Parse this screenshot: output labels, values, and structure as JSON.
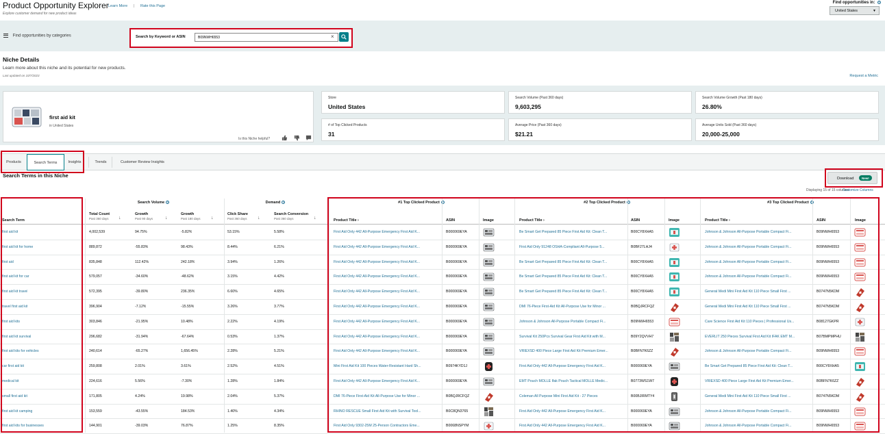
{
  "header": {
    "title": "Product Opportunity Explorer",
    "learn_more": "Learn More",
    "separator": "|",
    "rate_page": "Rate this Page",
    "subtitle": "Explore customer demand for new product ideas",
    "find_label": "Find opportunities in:",
    "country": "United States"
  },
  "search": {
    "categories_label": "Find opportunities by categories",
    "label": "Search by Keyword or ASIN",
    "value": "B09NWH6553"
  },
  "niche_details": {
    "title": "Niche Details",
    "description": "Learn more about this niche and its potential for new products.",
    "updated": "Last updated on 10/7/2023",
    "request_metric": "Request a Metric",
    "niche_name": "first aid kit",
    "niche_location": "in United States",
    "helpful": "Is this Niche helpful?",
    "stats": [
      {
        "label": "Store",
        "value": "United States"
      },
      {
        "label": "Search Volume (Past 360 days)",
        "value": "9,603,295"
      },
      {
        "label": "Search Volume Growth (Past 180 days)",
        "value": "26.80%"
      },
      {
        "label": "# of Top Clicked Products",
        "value": "31"
      },
      {
        "label": "Average Price (Past 360 days)",
        "value": "$21.21"
      },
      {
        "label": "Average Units Sold (Past 360 days)",
        "value": "20,000-25,000"
      }
    ]
  },
  "tabs": [
    "Products",
    "Search Terms",
    "Insights",
    "Trends",
    "Customer Review Insights"
  ],
  "section": {
    "title": "Search Terms in this Niche",
    "download": "Download",
    "new_badge": "New!",
    "displaying": "Displaying 15 of 15 columns",
    "customize": "Customize Columns"
  },
  "table": {
    "groups": {
      "search_volume": "Search Volume",
      "demand": "Demand",
      "top1": "#1 Top Clicked Product",
      "top2": "#2 Top Clicked Product",
      "top3": "#3 Top Clicked Product"
    },
    "columns": {
      "term": "Search Term",
      "total": "Total Count",
      "total_sub": "Past 360 days",
      "g90": "Growth",
      "g90_sub": "Past 90 days",
      "g180": "Growth",
      "g180_sub": "Past 180 days",
      "click": "Click Share",
      "click_sub": "Past 360 days",
      "conv": "Search Conversion",
      "conv_sub": "Past 360 days",
      "title": "Product Title",
      "asin": "ASIN",
      "image": "Image"
    },
    "rows": [
      {
        "term": "first aid kit",
        "total": "4,002,539",
        "g90": "94.75%",
        "g180": "-5.82%",
        "click": "53.15%",
        "conv": "5.58%",
        "p1": "First Aid Only 442 All-Purpose Emergency First Aid K...",
        "a1": "B000069EYA",
        "i1": "kit-box",
        "p2": "Be Smart Get Prepared 85 Piece First Aid Kit: Clean T...",
        "a2": "B00CY8XHA5",
        "i2": "kit-teal",
        "p3": "Johnson & Johnson All-Purpose Portable Compact Fi...",
        "a3": "B09NWH6553",
        "i3": "kit-red"
      },
      {
        "term": "first aid kit for home",
        "total": "889,872",
        "g90": "-55.83%",
        "g180": "98.43%",
        "click": "8.44%",
        "conv": "6.21%",
        "p1": "First Aid Only 442 All-Purpose Emergency First Aid K...",
        "a1": "B000069EYA",
        "i1": "kit-box",
        "p2": "First Aid Only 91248 OSHA-Compliant All-Purpose 5...",
        "a2": "B0BF27LHJ4",
        "i2": "kit-white",
        "p3": "Johnson & Johnson All-Purpose Portable Compact Fi...",
        "a3": "B09NWH6553",
        "i3": "kit-red"
      },
      {
        "term": "first aid",
        "total": "835,848",
        "g90": "112.42%",
        "g180": "242.18%",
        "click": "3.94%",
        "conv": "1.26%",
        "p1": "First Aid Only 442 All-Purpose Emergency First Aid K...",
        "a1": "B000069EYA",
        "i1": "kit-box",
        "p2": "Be Smart Get Prepared 85 Piece First Aid Kit: Clean T...",
        "a2": "B00CY8XHA5",
        "i2": "kit-teal",
        "p3": "Johnson & Johnson All-Purpose Portable Compact Fi...",
        "a3": "B09NWH6553",
        "i3": "kit-red"
      },
      {
        "term": "first aid kit for car",
        "total": "579,057",
        "g90": "-34.60%",
        "g180": "-48.62%",
        "click": "3.15%",
        "conv": "4.42%",
        "p1": "First Aid Only 442 All-Purpose Emergency First Aid K...",
        "a1": "B000069EYA",
        "i1": "kit-box",
        "p2": "Be Smart Get Prepared 85 Piece First Aid Kit: Clean T...",
        "a2": "B00CY8XHA5",
        "i2": "kit-teal",
        "p3": "Johnson & Johnson All-Purpose Portable Compact Fi...",
        "a3": "B09NWH6553",
        "i3": "kit-red"
      },
      {
        "term": "first aid kit travel",
        "total": "572,395",
        "g90": "-39.80%",
        "g180": "236.35%",
        "click": "6.60%",
        "conv": "4.65%",
        "p1": "First Aid Only 442 All-Purpose Emergency First Aid K...",
        "a1": "B000069EYA",
        "i1": "kit-box",
        "p2": "Be Smart Get Prepared 85 Piece First Aid Kit: Clean T...",
        "a2": "B00CY8XHA5",
        "i2": "kit-teal",
        "p3": "General Medi Mini First Aid Kit 110 Piece Small First ...",
        "a3": "B0747N5KDM",
        "i3": "kit-red-bag"
      },
      {
        "term": "travel first aid kit",
        "total": "396,904",
        "g90": "-7.12%",
        "g180": "-15.55%",
        "click": "3.26%",
        "conv": "3.77%",
        "p1": "First Aid Only 442 All-Purpose Emergency First Aid K...",
        "a1": "B000069EYA",
        "i1": "kit-box",
        "p2": "DMI 76-Piece First-Aid Kit All-Purpose Use for Minor ...",
        "a2": "B0BQJRCFQZ",
        "i2": "kit-red-bag",
        "p3": "General Medi Mini First Aid Kit 110 Piece Small First ...",
        "a3": "B0747N5KDM",
        "i3": "kit-red-bag"
      },
      {
        "term": "first aid kits",
        "total": "303,846",
        "g90": "-21.95%",
        "g180": "10.48%",
        "click": "2.22%",
        "conv": "4.19%",
        "p1": "First Aid Only 442 All-Purpose Emergency First Aid K...",
        "a1": "B000069EYA",
        "i1": "kit-box",
        "p2": "Johnson & Johnson All-Purpose Portable Compact Fi...",
        "a2": "B09NWH6553",
        "i2": "kit-red",
        "p3": "Care Science First Aid Kit 110 Pieces | Professional Us...",
        "a3": "B08127GKPR",
        "i3": "kit-white"
      },
      {
        "term": "first aid kit survival",
        "total": "296,682",
        "g90": "-31.94%",
        "g180": "-67.64%",
        "click": "0.53%",
        "conv": "1.37%",
        "p1": "First Aid Only 442 All-Purpose Emergency First Aid K...",
        "a1": "B000069EYA",
        "i1": "kit-box",
        "p2": "Survival Kit 250Pcs Survival Gear First Aid Kit with M...",
        "a2": "B09Y2QVVH7",
        "i2": "kit-gear",
        "p3": "EVERLIT 250 Pieces Survival First Aid Kit IFAK EMT M...",
        "a3": "B07BMPMPHU",
        "i3": "kit-gear"
      },
      {
        "term": "first aid kits for vehicles",
        "total": "240,614",
        "g90": "-65.27%",
        "g180": "1,656.45%",
        "click": "2.28%",
        "conv": "5.21%",
        "p1": "First Aid Only 442 All-Purpose Emergency First Aid K...",
        "a1": "B000069EYA",
        "i1": "kit-box",
        "p2": "VRIEXSD 400 Piece Large First Aid Kit Premium Emer...",
        "a2": "B0BFN7K6ZZ",
        "i2": "kit-red-bag",
        "p3": "Johnson & Johnson All-Purpose Portable Compact Fi...",
        "a3": "B09NWH6553",
        "i3": "kit-red"
      },
      {
        "term": "car first aid kit",
        "total": "259,808",
        "g90": "2.01%",
        "g180": "3.61%",
        "click": "2.52%",
        "conv": "4.51%",
        "p1": "Mini First Aid Kit 100 Pieces Water-Resistant Hard Sh...",
        "a1": "B0974KYD1J",
        "i1": "kit-black",
        "p2": "First Aid Only 442 All-Purpose Emergency First Aid K...",
        "a2": "B000069EYA",
        "i2": "kit-box",
        "p3": "Be Smart Get Prepared 85 Piece First Aid Kit: Clean T...",
        "a3": "B00CY8XHA5",
        "i3": "kit-teal"
      },
      {
        "term": "medical kit",
        "total": "224,616",
        "g90": "5.56%",
        "g180": "-7.30%",
        "click": "1.28%",
        "conv": "1.84%",
        "p1": "First Aid Only 442 All-Purpose Emergency First Aid K...",
        "a1": "B000069EYA",
        "i1": "kit-box",
        "p2": "EMT Pouch MOLLE Ifak Pouch Tactical MOLLE Medic...",
        "a2": "B0773WS1W7",
        "i2": "kit-black",
        "p3": "VRIEXSD 400 Piece Large First Aid Kit Premium Emer...",
        "a3": "B0BFN7K6ZZ",
        "i3": "kit-red-bag"
      },
      {
        "term": "small first aid kit",
        "total": "171,805",
        "g90": "4.24%",
        "g180": "19.98%",
        "click": "2.04%",
        "conv": "5.37%",
        "p1": "DMI 76-Piece First-Aid Kit All-Purpose Use for Minor ...",
        "a1": "B0BQJRCFQZ",
        "i1": "kit-red-bag",
        "p2": "Coleman All Purpose Mini First Aid Kit - 27 Pieces",
        "a2": "B00BJIRMTY4",
        "i2": "kit-grey",
        "p3": "General Medi Mini First Aid Kit 110 Piece Small First ...",
        "a3": "B0747N5KDM",
        "i3": "kit-red-bag"
      },
      {
        "term": "first aid kit camping",
        "total": "153,559",
        "g90": "-43.55%",
        "g180": "184.53%",
        "click": "1.40%",
        "conv": "4.34%",
        "p1": "RHINO RESCUE Small First Aid Kit with Survival Tool...",
        "a1": "B0C8QN3765",
        "i1": "kit-gear",
        "p2": "First Aid Only 442 All-Purpose Emergency First Aid K...",
        "a2": "B000069EYA",
        "i2": "kit-box",
        "p3": "Johnson & Johnson All-Purpose Portable Compact Fi...",
        "a3": "B09NWH6553",
        "i3": "kit-red"
      },
      {
        "term": "first aid kits for businesses",
        "total": "144,901",
        "g90": "-39.03%",
        "g180": "76.87%",
        "click": "1.25%",
        "conv": "8.35%",
        "p1": "First Aid Only 9302-25M 25-Person Contractors Eme...",
        "a1": "B0068NSPYM",
        "i1": "kit-white",
        "p2": "First Aid Only 442 All-Purpose Emergency First Aid K...",
        "a2": "B000069EYA",
        "i2": "kit-box",
        "p3": "Johnson & Johnson All-Purpose Portable Compact Fi...",
        "a3": "B09NWH6553",
        "i3": "kit-red"
      }
    ]
  },
  "colors": {
    "accent": "#027f8a",
    "link": "#1f6f95",
    "highlight": "#d0021b",
    "badge": "#067d62"
  }
}
